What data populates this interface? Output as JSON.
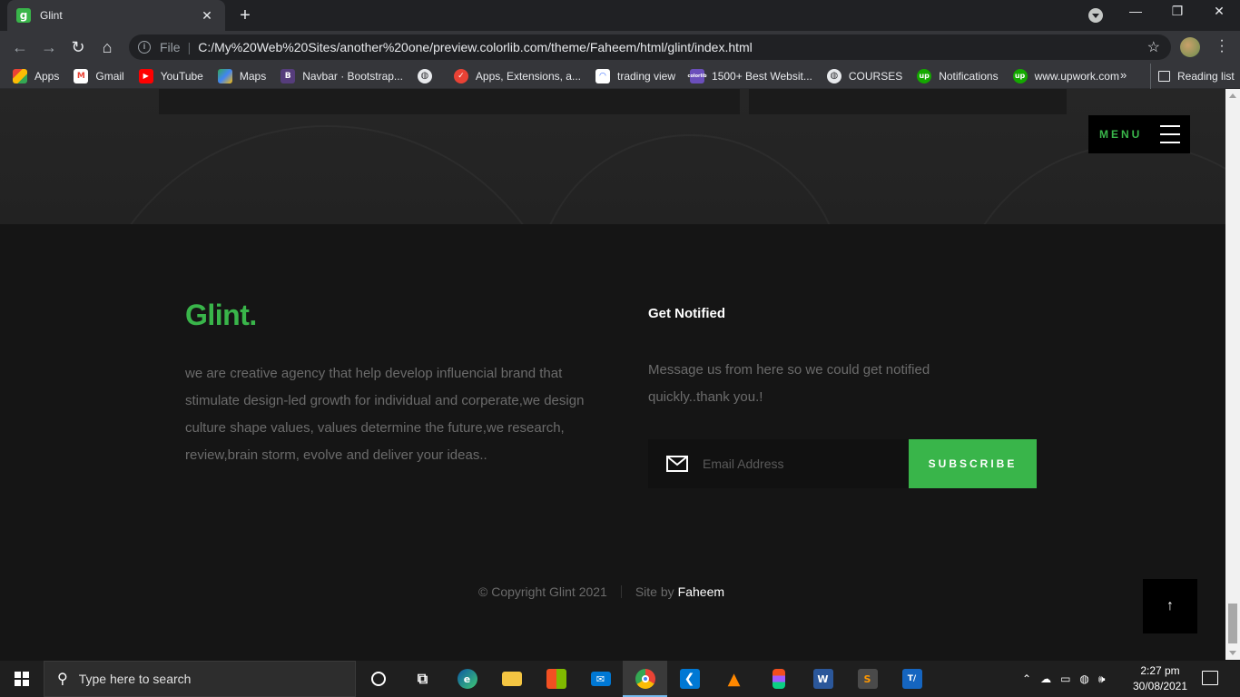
{
  "browser": {
    "tab_title": "Glint",
    "tab_favicon": "g",
    "tab_close": "✕",
    "new_tab": "+",
    "file_label": "File",
    "url": "C:/My%20Web%20Sites/another%20one/preview.colorlib.com/theme/Faheem/html/glint/index.html",
    "bookmarks": [
      {
        "label": "Apps",
        "icon": "apps-grid-icon"
      },
      {
        "label": "Gmail",
        "icon": "gmail-icon"
      },
      {
        "label": "YouTube",
        "icon": "youtube-icon"
      },
      {
        "label": "Maps",
        "icon": "maps-icon"
      },
      {
        "label": "Navbar · Bootstrap...",
        "icon": "bootstrap-icon"
      },
      {
        "label": "",
        "icon": "globe-icon"
      },
      {
        "label": "Apps, Extensions, a...",
        "icon": "extensions-icon"
      },
      {
        "label": "trading view",
        "icon": "tradingview-icon"
      },
      {
        "label": "1500+ Best Websit...",
        "icon": "colorlib-icon"
      },
      {
        "label": "COURSES",
        "icon": "globe-icon"
      },
      {
        "label": "Notifications",
        "icon": "upwork-icon"
      },
      {
        "label": "www.upwork.com",
        "icon": "upwork-icon"
      }
    ],
    "bookmarks_more": "»",
    "reading_list": "Reading list"
  },
  "page": {
    "menu_label": "MENU",
    "footer": {
      "logo": "Glint.",
      "about": "we are creative agency that help develop influencial brand that stimulate design-led growth for individual and corperate,we design culture shape values, values determine the future,we research, review,brain storm, evolve and deliver your ideas..",
      "notify_title": "Get Notified",
      "notify_text": "Message us from here so we could get notified quickly..thank you.!",
      "email_placeholder": "Email Address",
      "subscribe_label": "SUBSCRIBE",
      "copyright": "© Copyright Glint 2021",
      "site_by": "Site by",
      "site_by_name": "Faheem",
      "go_top": "↑"
    }
  },
  "taskbar": {
    "search_placeholder": "Type here to search",
    "time": "2:27 pm",
    "date": "30/08/2021"
  },
  "colors": {
    "accent": "#39b54a",
    "page_bg": "#151515",
    "text_muted": "#6b6b6b"
  }
}
